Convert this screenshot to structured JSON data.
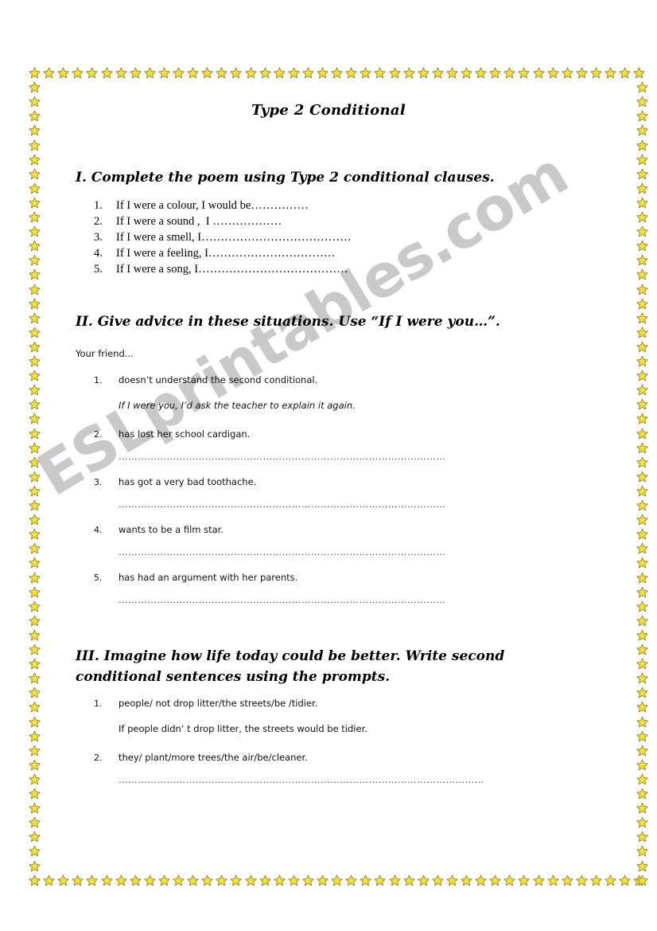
{
  "document": {
    "title": "Type 2 Conditional",
    "watermark": "ESLprintables.com",
    "border_icon": "star-icon",
    "colors": {
      "star_fill": "#F5E33C",
      "star_stroke": "#8F8320",
      "watermark": "#C9C9C9",
      "text": "#000000",
      "page_background": "#FFFFFF"
    }
  },
  "sections": [
    {
      "heading": "I. Complete the poem using Type 2 conditional clauses.",
      "items": [
        {
          "number": "1.",
          "prompt": "If I were a colour, I would be……………"
        },
        {
          "number": "2.",
          "prompt": "If I were a sound ,  I ………………"
        },
        {
          "number": "3.",
          "prompt": "If I were a smell, I…………………………………"
        },
        {
          "number": "4.",
          "prompt": "If I were a feeling, I……………………………"
        },
        {
          "number": "5.",
          "prompt": "If I were a song, I…………………………………"
        }
      ]
    },
    {
      "heading": "II. Give advice in these situations. Use “If I were you…”.",
      "note": "Your friend...",
      "items": [
        {
          "number": "1.",
          "prompt": "doesn’t understand the second conditional.",
          "answer": "If I were you, I’d ask the teacher to explain it again.",
          "answer_style": "italic"
        },
        {
          "number": "2.",
          "prompt": "has lost her school cardigan.",
          "answer": "",
          "dots": "…………………………………………………………………………………………"
        },
        {
          "number": "3.",
          "prompt": "has got a very bad toothache.",
          "answer": "",
          "dots": "…………………………………………………………………………………………"
        },
        {
          "number": "4.",
          "prompt": "wants to be a film star.",
          "answer": "",
          "dots": "…………………………………………………………………………………………"
        },
        {
          "number": "5.",
          "prompt": "has had an argument with her parents.",
          "answer": "",
          "dots": "…………………………………………………………………………………………"
        }
      ]
    },
    {
      "heading": "III. Imagine how life today could be better. Write second conditional sentences using the prompts.",
      "items": [
        {
          "number": "1.",
          "prompt": "people/ not drop litter/the streets/be /tidier.",
          "answer": "If people didn‘ t drop litter, the streets would be tidier.",
          "answer_style": "normal"
        },
        {
          "number": "2.",
          "prompt": "they/ plant/more trees/the air/be/cleaner.",
          "answer": "",
          "dots": "……………………………………………………………………………………………………"
        }
      ]
    }
  ]
}
